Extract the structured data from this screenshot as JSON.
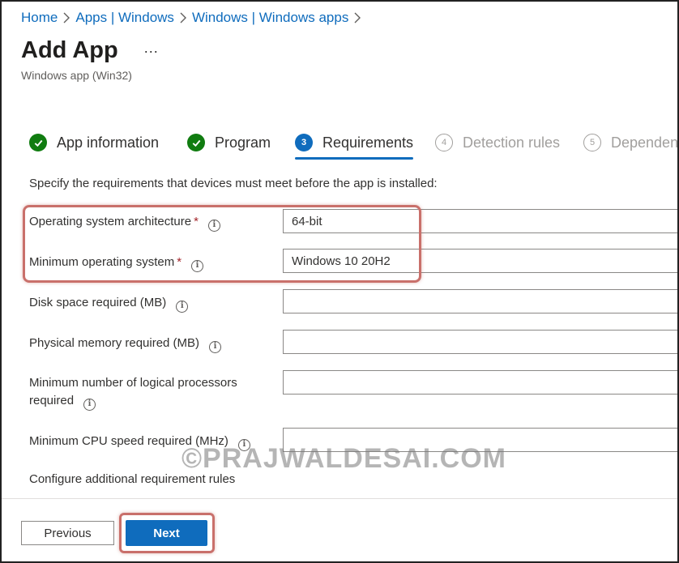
{
  "breadcrumb": [
    "Home",
    "Apps | Windows",
    "Windows | Windows apps"
  ],
  "page": {
    "title": "Add App",
    "more_label": "...",
    "subtitle": "Windows app (Win32)"
  },
  "steps": [
    {
      "label": "App information",
      "state": "done"
    },
    {
      "label": "Program",
      "state": "done"
    },
    {
      "label": "Requirements",
      "state": "current",
      "number": "3"
    },
    {
      "label": "Detection rules",
      "state": "pending",
      "number": "4"
    },
    {
      "label": "Dependencies",
      "state": "pending",
      "number": "5"
    }
  ],
  "description": "Specify the requirements that devices must meet before the app is installed:",
  "fields": [
    {
      "label": "Operating system architecture",
      "required": "*",
      "value": "64-bit"
    },
    {
      "label": "Minimum operating system",
      "required": "*",
      "value": "Windows 10 20H2"
    },
    {
      "label": "Disk space required (MB)",
      "value": ""
    },
    {
      "label": "Physical memory required (MB)",
      "value": ""
    },
    {
      "label_line1": "Minimum number of logical processors",
      "label_line2": "required",
      "value": ""
    },
    {
      "label": "Minimum CPU speed required (MHz)",
      "value": ""
    }
  ],
  "additional_rules_label": "Configure additional requirement rules",
  "watermark": "©PRAJWALDESAI.COM",
  "footer": {
    "previous_label": "Previous",
    "next_label": "Next"
  },
  "colors": {
    "accent": "#0f6cbd",
    "done": "#107c10",
    "highlight": "#c9706b"
  }
}
